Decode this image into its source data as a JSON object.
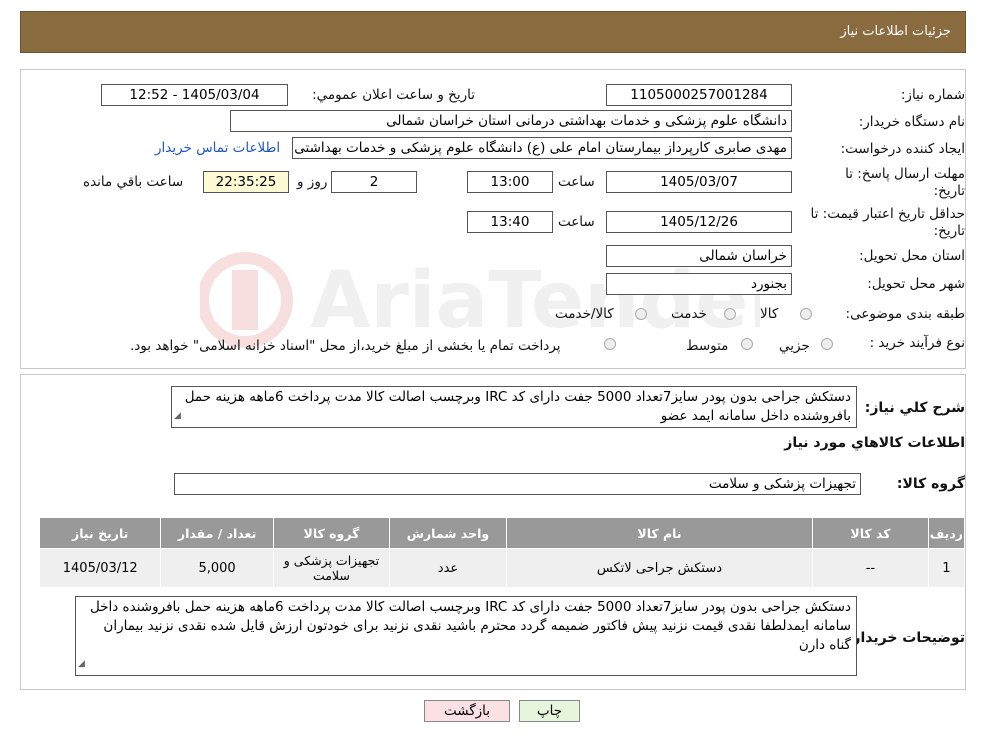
{
  "header": {
    "title": "جزئیات اطلاعات نیاز"
  },
  "fields": {
    "need_number_label": "شماره نیاز:",
    "need_number": "1105000257001284",
    "announce_label": "تاریخ و ساعت اعلان عمومي:",
    "announce_value": "1405/03/04 - 12:52",
    "buyer_org_label": "نام دستگاه خریدار:",
    "buyer_org": "دانشگاه علوم پزشکی و خدمات بهداشتی درمانی استان خراسان شمالی",
    "creator_label": "ایجاد کننده درخواست:",
    "creator": "مهدی صابری کارپرداز بیمارستان امام علی (ع) دانشگاه علوم پزشکی و خدمات بهداشتی",
    "contact_link": "اطلاعات تماس خریدار",
    "deadline_label": "مهلت ارسال پاسخ: تا تاریخ:",
    "deadline_date": "1405/03/07",
    "time_label": "ساعت",
    "deadline_time": "13:00",
    "days_value": "2",
    "days_label": "روز و",
    "remaining_time": "22:35:25",
    "remaining_label": "ساعت باقي مانده",
    "validity_label": "حداقل تاریخ اعتبار قیمت: تا تاریخ:",
    "validity_date": "1405/12/26",
    "validity_time": "13:40",
    "province_label": "استان محل تحویل:",
    "province": "خراسان شمالی",
    "city_label": "شهر محل تحویل:",
    "city": "بجنورد",
    "category_label": "طبقه بندی موضوعی:",
    "category_options": [
      "کالا",
      "خدمت",
      "کالا/خدمت"
    ],
    "process_label": "نوع فرآیند خرید :",
    "process_options": [
      "جزیي",
      "متوسط"
    ],
    "process_note": "پرداخت تمام یا بخشی از مبلغ خرید،از محل \"اسناد خزانه اسلامی\" خواهد بود."
  },
  "description": {
    "label": "شرح کلي نیاز:",
    "text": "دستکش جراحی بدون پودر سایز7تعداد 5000 جفت  دارای  کد IRC وبرچسب اصالت کالا مدت پرداخت 6ماهه هزینه حمل بافروشنده داخل سامانه ایمد عضو"
  },
  "goods": {
    "section_title": "اطلاعات کالاهاي مورد نیاز",
    "group_label": "گروه کالا:",
    "group_value": "تجهیزات پزشکی و سلامت"
  },
  "table": {
    "headers": [
      "ردیف",
      "کد کالا",
      "نام کالا",
      "واحد شمارش",
      "گروه کالا",
      "تعداد / مقدار",
      "تاریخ نیاز"
    ],
    "rows": [
      [
        "1",
        "--",
        "دستکش جراحی لاتکس",
        "عدد",
        "تجهیزات پزشکی و سلامت",
        "5,000",
        "1405/03/12"
      ]
    ]
  },
  "buyer_notes": {
    "label": "توضیحات خریدار:",
    "text": "دستکش جراحی بدون پودر سایز7تعداد 5000 جفت  دارای  کد IRC وبرچسب اصالت کالا مدت پرداخت 6ماهه هزینه حمل بافروشنده داخل سامانه ایمدلطفا نقدی قیمت نزنید  پیش فاکتور ضمیمه گردد محترم باشید نقدی نزنید برای خودتون ارزش قایل شده نقدی نزنید بیماران گناه دارن"
  },
  "buttons": {
    "print": "چاپ",
    "back": "بازگشت"
  },
  "colors": {
    "header_bg": "#8a6a3f",
    "table_header": "#999999",
    "yellow_box": "#fdfbd3",
    "link": "#1e57c4",
    "back_btn": "#fbe1e3",
    "print_btn": "#e6f6dc"
  }
}
